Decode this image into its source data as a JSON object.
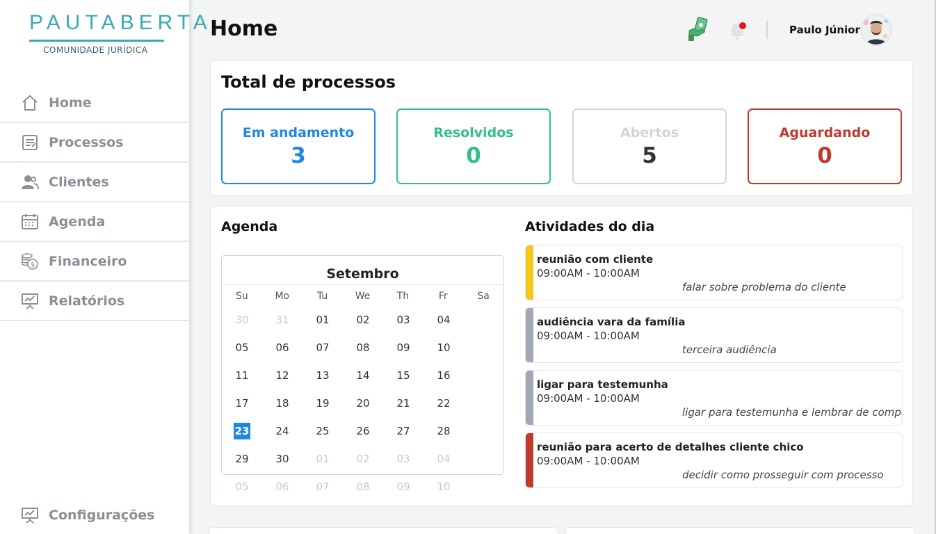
{
  "brand": {
    "name": "PAUTABERTA",
    "tagline": "COMUNIDADE JURÍDICA"
  },
  "sidebar": {
    "items": [
      {
        "label": "Home",
        "icon": "home-icon"
      },
      {
        "label": "Processos",
        "icon": "document-icon"
      },
      {
        "label": "Clientes",
        "icon": "users-icon"
      },
      {
        "label": "Agenda",
        "icon": "calendar-icon"
      },
      {
        "label": "Financeiro",
        "icon": "coins-icon"
      },
      {
        "label": "Relatórios",
        "icon": "presentation-icon"
      }
    ],
    "settings": {
      "label": "Configurações",
      "icon": "presentation-icon"
    }
  },
  "header": {
    "title": "Home",
    "user_name": "Paulo Júnior"
  },
  "totals": {
    "title": "Total de processos",
    "stats": [
      {
        "label": "Em andamento",
        "value": "3",
        "color": "#1e88e5"
      },
      {
        "label": "Resolvidos",
        "value": "0",
        "color": "#2fbf8a"
      },
      {
        "label": "Abertos",
        "value": "5",
        "color": "#d1d5db"
      },
      {
        "label": "Aguardando",
        "value": "0",
        "color": "#c0392b"
      }
    ]
  },
  "agenda": {
    "title": "Agenda",
    "month": "Setembro",
    "weekdays": [
      "Su",
      "Mo",
      "Tu",
      "We",
      "Th",
      "Fr",
      "Sa"
    ],
    "days": [
      [
        "30",
        "31",
        "01",
        "02",
        "03",
        "04",
        "05"
      ],
      [
        "06",
        "07",
        "08",
        "09",
        "10",
        "11",
        "12"
      ],
      [
        "13",
        "14",
        "15",
        "16",
        "17",
        "18",
        "19"
      ],
      [
        "20",
        "21",
        "22",
        "23",
        "24",
        "25",
        "26"
      ],
      [
        "27",
        "28",
        "29",
        "30",
        "01",
        "02",
        "03"
      ],
      [
        "04",
        "05",
        "06",
        "07",
        "08",
        "09",
        "10"
      ]
    ],
    "selected": "23"
  },
  "activities": {
    "title": "Atividades do dia",
    "items": [
      {
        "title": "reunião com cliente",
        "time": "09:00AM - 10:00AM",
        "description": "falar sobre problema do cliente",
        "color": "#f5c518"
      },
      {
        "title": "audiência vara da família",
        "time": "09:00AM - 10:00AM",
        "description": "terceira audiência",
        "color": "#a3a8b8"
      },
      {
        "title": "ligar para testemunha",
        "time": "09:00AM - 10:00AM",
        "description": "ligar para testemunha e lembrar de compa",
        "color": "#a3a8b8"
      },
      {
        "title": "reunião para acerto de detalhes cliente chico",
        "time": "09:00AM - 10:00AM",
        "description": "decidir como prosseguir com processo",
        "color": "#c0392b"
      }
    ]
  }
}
